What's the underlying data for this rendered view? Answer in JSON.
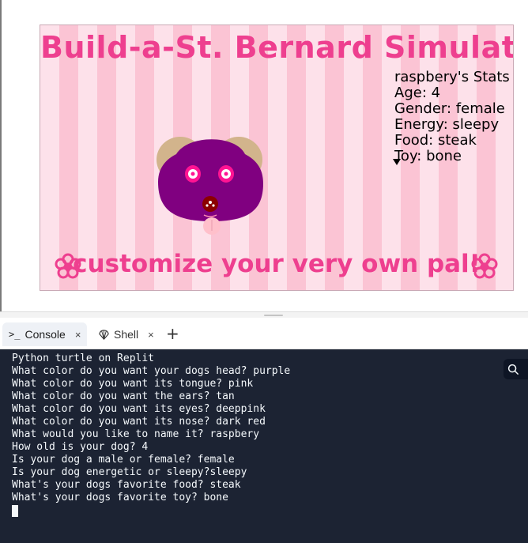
{
  "canvas": {
    "title": "Build-a-St. Bernard Simulator",
    "stats": [
      "raspbery's Stats",
      "Age: 4",
      "Gender: female",
      "Energy: sleepy",
      "Food: steak",
      "Toy: bone"
    ],
    "tagline": "customize your very own pal!",
    "dog_colors": {
      "head": "#800080",
      "tongue": "#ffc0cb",
      "ears": "#d2b48c",
      "eyes": "#ff1493",
      "nose": "#8b0000"
    }
  },
  "tabs": {
    "console": {
      "label": "Console",
      "icon": "terminal-icon",
      "close": "×"
    },
    "shell": {
      "label": "Shell",
      "icon": "shell-icon",
      "close": "×"
    },
    "add": "+"
  },
  "console": {
    "lines": [
      "Python turtle on Replit",
      "What color do you want your dogs head? purple",
      "What color do you want its tongue? pink",
      "What color do you want the ears? tan",
      "What color do you want its eyes? deeppink",
      "What color do you want its nose? dark red",
      "What would you like to name it? raspbery",
      "How old is your dog? 4",
      "Is your dog a male or female? female",
      "Is your dog energetic or sleepy?sleepy",
      "What's your dogs favorite food? steak",
      "What's your dogs favorite toy? bone"
    ]
  },
  "colors": {
    "console_bg": "#1c2333",
    "title_pink": "#ee3f8f"
  }
}
